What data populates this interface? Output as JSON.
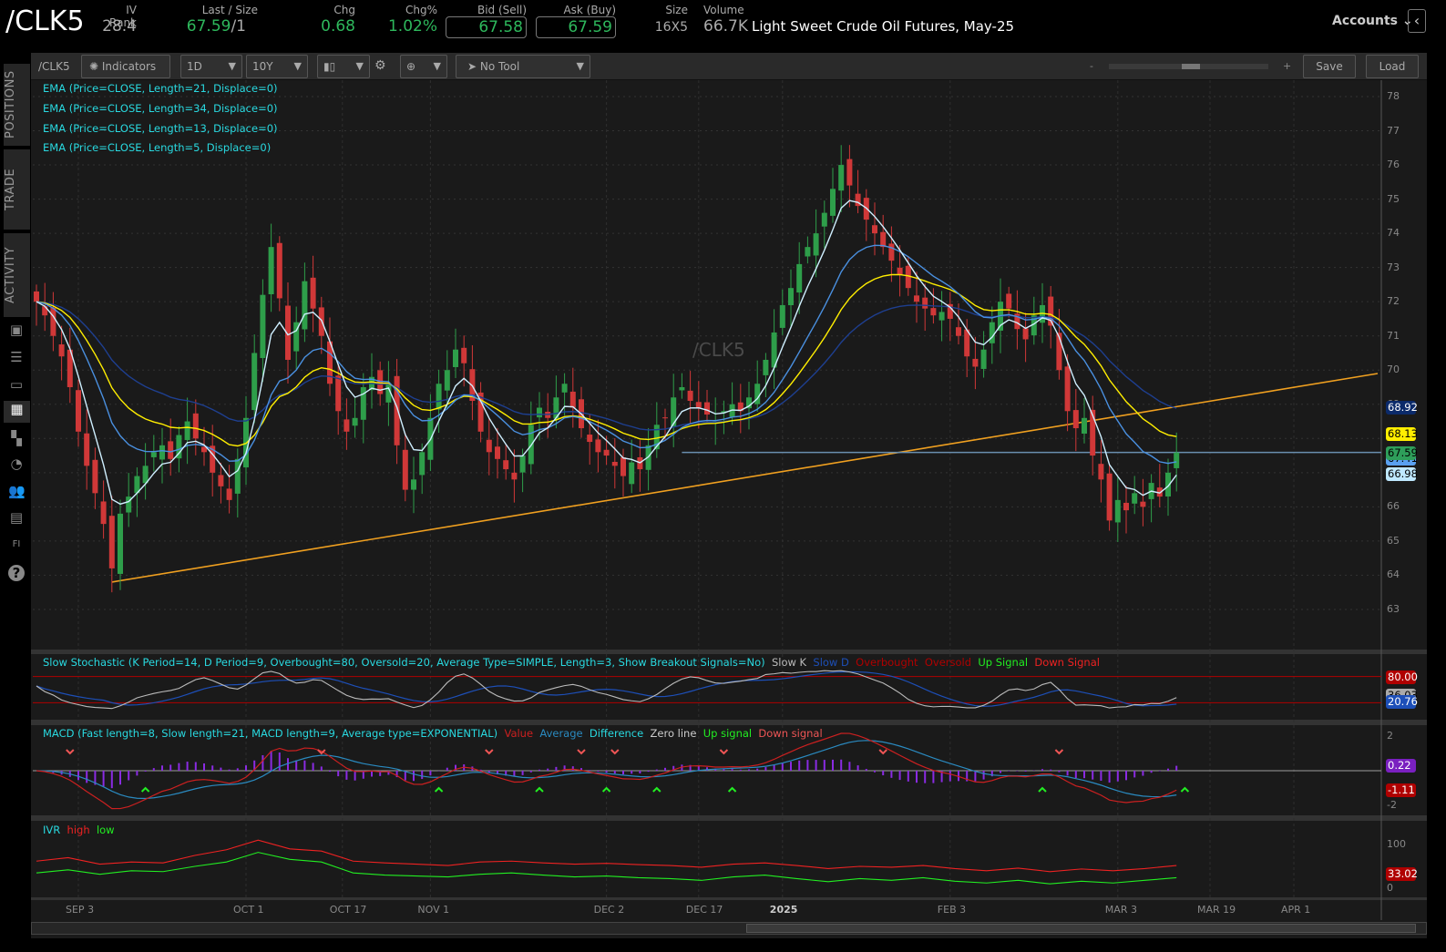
{
  "header": {
    "symbol": "/CLK5",
    "iv_rank_label": "IV Rank",
    "iv_rank": "28.4",
    "last_size_label": "Last / Size",
    "last": "67.59",
    "size": "/1",
    "chg_label": "Chg",
    "chg": "0.68",
    "chg_pct_label": "Chg%",
    "chg_pct": "1.02%",
    "bid_label": "Bid (Sell)",
    "bid": "67.58",
    "ask_label": "Ask (Buy)",
    "ask": "67.59",
    "size2_label": "Size",
    "size2": "16X5",
    "volume_label": "Volume",
    "volume": "66.7K",
    "description": "Light Sweet Crude Oil Futures, May-25",
    "accounts": "Accounts"
  },
  "sidebar": {
    "tabs": [
      "POSITIONS",
      "TRADE",
      "ACTIVITY"
    ],
    "icons": [
      "monitor-icon",
      "list-icon",
      "tv-icon",
      "chart-icon",
      "grid-icon",
      "clock-icon",
      "people-icon",
      "calendar-icon",
      "fi-icon",
      "help-icon"
    ]
  },
  "toolbar": {
    "symbol": "/CLK5",
    "indicators": "Indicators",
    "aggregation": "1D",
    "range": "10Y",
    "tool": "No Tool",
    "zoom_minus": "-",
    "zoom_plus": "+",
    "save": "Save",
    "load": "Load"
  },
  "price_pane": {
    "watermark": "/CLK5",
    "studies": [
      "EMA (Price=CLOSE, Length=21, Displace=0)",
      "EMA (Price=CLOSE, Length=34, Displace=0)",
      "EMA (Price=CLOSE, Length=13, Displace=0)",
      "EMA (Price=CLOSE, Length=5, Displace=0)"
    ],
    "axis_ticks": [
      "78",
      "77",
      "76",
      "75",
      "74",
      "73",
      "72",
      "71",
      "70",
      "69",
      "68",
      "67",
      "66",
      "65",
      "64",
      "63"
    ],
    "badges": [
      {
        "text": "68.92",
        "bg": "#0b2a6a",
        "fg": "#fff",
        "value": 68.92
      },
      {
        "text": "68.13",
        "bg": "#ffee00",
        "fg": "#000",
        "value": 68.13
      },
      {
        "text": "67.41",
        "bg": "#5aa0f0",
        "fg": "#000",
        "value": 67.41
      },
      {
        "text": "67.59",
        "bg": "#2e9e5a",
        "fg": "#000",
        "value": 67.59
      },
      {
        "text": "66.98",
        "bg": "#bfe8ff",
        "fg": "#000",
        "value": 66.98
      }
    ]
  },
  "stoch": {
    "title": "Slow Stochastic (K Period=14, D Period=9, Overbought=80, Oversold=20, Average Type=SIMPLE, Length=3, Show Breakout Signals=No)",
    "legend": [
      {
        "t": "Slow K",
        "c": "#bbbbbb"
      },
      {
        "t": "Slow D",
        "c": "#1d4fb8"
      },
      {
        "t": "Overbought",
        "c": "#b00000"
      },
      {
        "t": "Oversold",
        "c": "#b00000"
      },
      {
        "t": "Up Signal",
        "c": "#22ee22"
      },
      {
        "t": "Down Signal",
        "c": "#ee2222"
      }
    ],
    "badges": [
      {
        "text": "80.00",
        "bg": "#b00000",
        "fg": "#fff"
      },
      {
        "text": "36.03",
        "bg": "#aaaaaa",
        "fg": "#000"
      },
      {
        "text": "20.76",
        "bg": "#1d4fb8",
        "fg": "#fff"
      }
    ]
  },
  "macd": {
    "title": "MACD (Fast length=8, Slow length=21, MACD length=9, Average type=EXPONENTIAL)",
    "legend": [
      {
        "t": "Value",
        "c": "#cc2020"
      },
      {
        "t": "Average",
        "c": "#2a8ac0"
      },
      {
        "t": "Difference",
        "c": "#29d9e0"
      },
      {
        "t": "Zero line",
        "c": "#cccccc"
      },
      {
        "t": "Up signal",
        "c": "#22ee22"
      },
      {
        "t": "Down signal",
        "c": "#ee5555"
      }
    ],
    "axis_ticks": [
      "2",
      "-2"
    ],
    "badges": [
      {
        "text": "0.22",
        "bg": "#7a20c0",
        "fg": "#fff"
      },
      {
        "text": "-1.11",
        "bg": "#b00000",
        "fg": "#fff"
      }
    ],
    "up_signals": [
      13,
      48,
      60,
      68,
      74,
      83,
      120,
      137
    ],
    "down_signals": [
      4,
      34,
      54,
      65,
      69,
      82,
      101,
      122
    ]
  },
  "ivr": {
    "title": "IVR",
    "legend": [
      {
        "t": "high",
        "c": "#ee2222"
      },
      {
        "t": "low",
        "c": "#22ee22"
      }
    ],
    "axis_ticks": [
      "100",
      "0"
    ],
    "badge": {
      "text": "33.02",
      "bg": "#b00000",
      "fg": "#fff"
    },
    "high": [
      62,
      70,
      55,
      60,
      58,
      75,
      88,
      110,
      90,
      85,
      62,
      58,
      55,
      52,
      60,
      62,
      58,
      55,
      57,
      54,
      52,
      48,
      55,
      58,
      52,
      45,
      50,
      48,
      52,
      45,
      40,
      46,
      38,
      44,
      40,
      45,
      52
    ],
    "low": [
      35,
      42,
      32,
      40,
      38,
      50,
      60,
      82,
      66,
      60,
      35,
      30,
      28,
      26,
      32,
      35,
      30,
      26,
      28,
      24,
      22,
      18,
      26,
      30,
      22,
      15,
      22,
      18,
      24,
      16,
      12,
      18,
      10,
      16,
      12,
      18,
      24
    ]
  },
  "xaxis": [
    {
      "t": "SEP 3",
      "bar": 5
    },
    {
      "t": "OCT 1",
      "bar": 25
    },
    {
      "t": "OCT 17",
      "bar": 36.5
    },
    {
      "t": "NOV 1",
      "bar": 47
    },
    {
      "t": "DEC 2",
      "bar": 68
    },
    {
      "t": "DEC 17",
      "bar": 79
    },
    {
      "t": "2025",
      "bar": 89
    },
    {
      "t": "FEB 3",
      "bar": 109
    },
    {
      "t": "MAR 3",
      "bar": 129
    },
    {
      "t": "MAR 19",
      "bar": 140
    },
    {
      "t": "APR 1",
      "bar": 150
    }
  ],
  "colors": {
    "up": "#2e9e4a",
    "down": "#d03838",
    "ema5": "#cfefff",
    "ema13": "#4a90e0",
    "ema21": "#ffee00",
    "ema34": "#1e3f90",
    "trend": "#f0a020",
    "hline": "#6a8fb0"
  },
  "chart_data": {
    "type": "candlestick",
    "symbol": "/CLK5",
    "ylim": [
      62.5,
      78.5
    ],
    "trendline": {
      "from": [
        9,
        63.8
      ],
      "to": [
        160,
        69.9
      ]
    },
    "hline": {
      "from_bar": 77,
      "value": 67.59
    },
    "closes": [
      72,
      71.6,
      71,
      70.4,
      69.5,
      68.2,
      67.2,
      66.4,
      65.5,
      64.2,
      65.8,
      66.3,
      66.9,
      67.2,
      67.6,
      67.8,
      67.4,
      68.1,
      68.5,
      68.0,
      67.6,
      67.0,
      66.6,
      66.2,
      67.4,
      68.6,
      70.5,
      72.2,
      73.6,
      72.1,
      70.3,
      71.4,
      72.6,
      71.8,
      71.0,
      69.6,
      68.8,
      68.2,
      68.6,
      69.5,
      69.8,
      69.3,
      69.6,
      67.8,
      66.5,
      66.8,
      67.6,
      68.6,
      69.6,
      70.0,
      70.6,
      70.2,
      69.1,
      68.2,
      67.6,
      67.4,
      67.1,
      66.8,
      67.5,
      68.4,
      68.9,
      68.6,
      69.2,
      69.6,
      68.9,
      68.3,
      67.9,
      67.6,
      67.5,
      67.2,
      66.9,
      67.3,
      67.1,
      67.8,
      68.4,
      68.6,
      69.2,
      69.5,
      69.1,
      68.9,
      68.7,
      68.5,
      68.8,
      69.0,
      68.8,
      69.2,
      69.6,
      70.3,
      71.1,
      71.9,
      72.4,
      73.1,
      73.6,
      74.0,
      74.6,
      75.3,
      76.0,
      75.4,
      74.8,
      74.4,
      74.0,
      73.6,
      73.2,
      72.8,
      72.4,
      72.0,
      71.8,
      71.6,
      71.7,
      71.5,
      71.0,
      70.4,
      70.1,
      70.6,
      71.4,
      72.0,
      71.8,
      71.2,
      70.9,
      71.6,
      71.9,
      71.3,
      70.0,
      68.8,
      68.3,
      68.6,
      67.5,
      66.8,
      65.6,
      66.2,
      65.9,
      66.4,
      66.0,
      66.7,
      66.3,
      67.0,
      67.59
    ]
  }
}
